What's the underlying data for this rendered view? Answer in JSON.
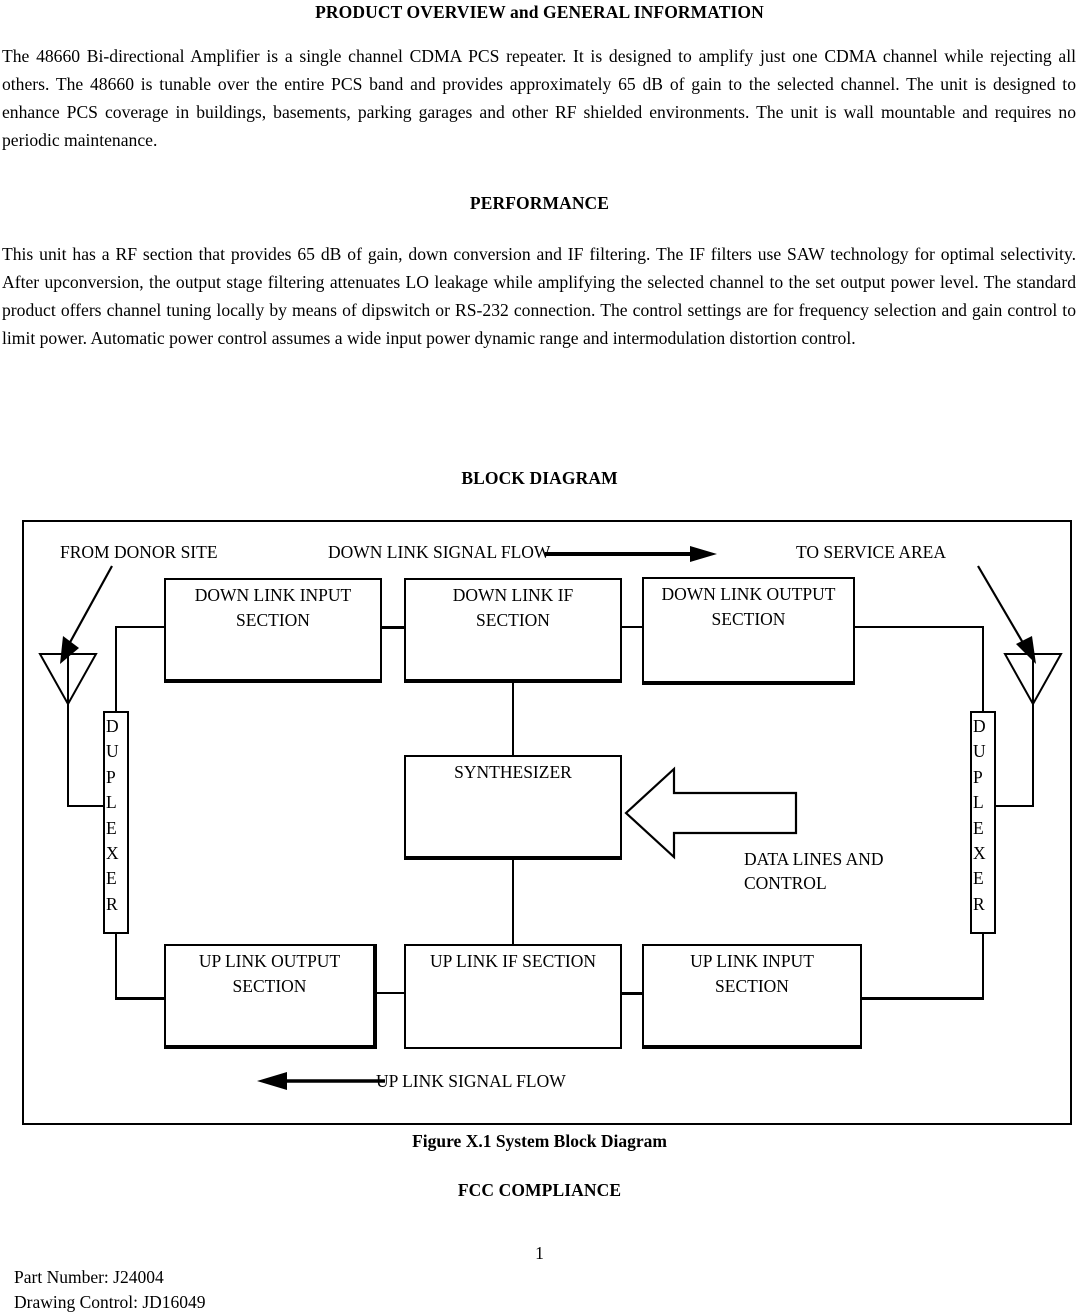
{
  "document": {
    "title": "PRODUCT OVERVIEW and GENERAL INFORMATION",
    "paragraph1": "The 48660 Bi-directional Amplifier is a single channel CDMA PCS repeater.  It is designed to amplify just one CDMA channel while rejecting all others.   The 48660 is tunable over the entire PCS band and provides approximately 65 dB of gain to the selected channel.  The unit is designed to enhance PCS coverage in buildings, basements, parking garages and other RF shielded environments.   The unit is wall mountable and requires no periodic maintenance.",
    "performance_heading": "PERFORMANCE",
    "paragraph2": "This unit has a RF section that provides 65 dB of gain, down conversion and IF filtering. The IF filters use SAW technology for optimal selectivity. After upconversion, the output stage filtering attenuates LO leakage while amplifying the selected channel to the set output power level.  The standard product offers channel tuning locally by means of dipswitch or RS-232 connection.  The control settings are for frequency selection and gain control to limit power.   Automatic power control assumes a wide input power dynamic range and intermodulation distortion control.",
    "block_diagram_heading": "BLOCK DIAGRAM",
    "figure_caption": "Figure X.1  System Block Diagram",
    "fcc_heading": "FCC COMPLIANCE",
    "page_number": "1",
    "part_number": "Part Number: J24004",
    "drawing_control": "Drawing Control: JD16049"
  },
  "diagram": {
    "labels": {
      "from_donor_site": "FROM DONOR SITE",
      "down_link_signal_flow": "DOWN LINK SIGNAL FLOW",
      "to_service_area": "TO SERVICE AREA",
      "data_lines_and_control": "DATA LINES AND\nCONTROL",
      "up_link_signal_flow": "UP LINK SIGNAL FLOW"
    },
    "blocks": {
      "down_link_input": "DOWN LINK INPUT\nSECTION",
      "down_link_if": "DOWN LINK IF\nSECTION",
      "down_link_output": "DOWN LINK OUTPUT\nSECTION",
      "synthesizer": "SYNTHESIZER",
      "up_link_output": "UP LINK OUTPUT\nSECTION",
      "up_link_if": "UP LINK IF SECTION",
      "up_link_input": "UP LINK INPUT\nSECTION"
    },
    "duplexer_letters": [
      "D",
      "U",
      "P",
      "L",
      "E",
      "X",
      "E",
      "R"
    ],
    "duplexer_label": "DUPLEXER",
    "colors": {
      "ink": "#000000",
      "paper": "#ffffff"
    }
  }
}
